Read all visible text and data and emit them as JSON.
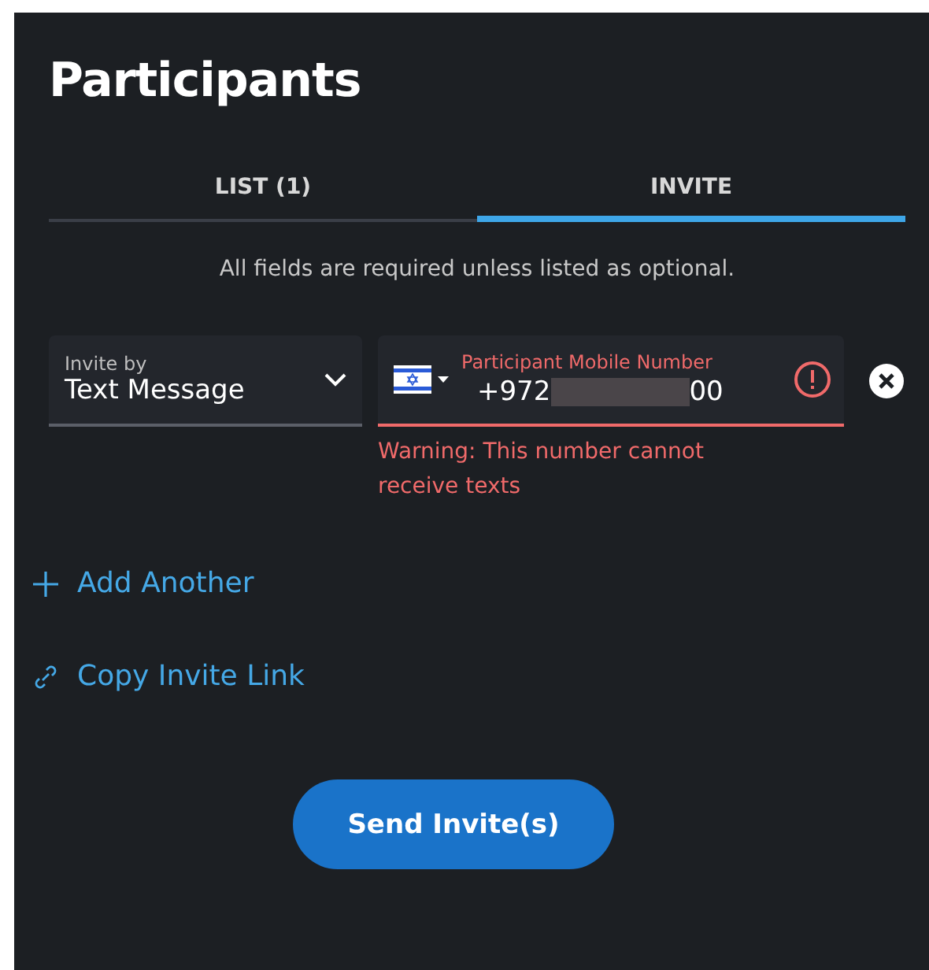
{
  "title": "Participants",
  "tabs": [
    {
      "label": "LIST (1)",
      "selected": false
    },
    {
      "label": "INVITE",
      "selected": true
    }
  ],
  "note": "All fields are required unless listed as optional.",
  "invite_by": {
    "label": "Invite by",
    "value": "Text Message"
  },
  "phone": {
    "label": "Participant Mobile Number",
    "value_start": "+972",
    "value_end": "00",
    "redacted": true,
    "error": true,
    "warning": "Warning: This number cannot receive texts"
  },
  "links": [
    {
      "kind": "add",
      "label": "Add Another"
    },
    {
      "kind": "link",
      "label": "Copy Invite Link"
    }
  ],
  "submit": "Send Invite(s)"
}
